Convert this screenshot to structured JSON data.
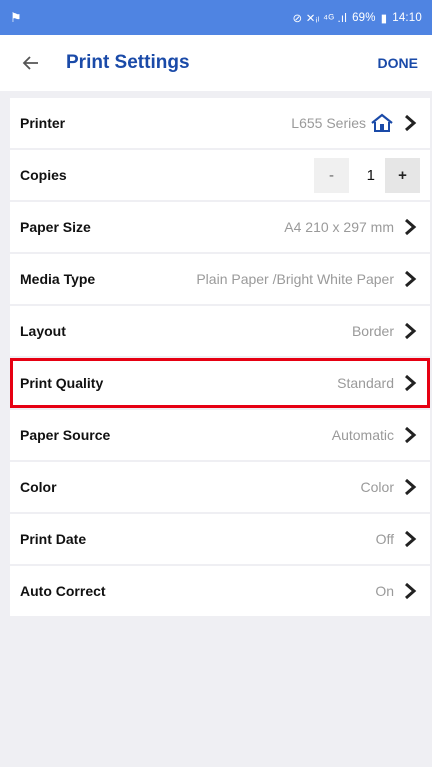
{
  "status_bar": {
    "left_icon": "notification-icon",
    "right_text": "69%",
    "time": "14:10",
    "signal_glyphs": "⊘ ✕ᵢₗ ⁴ᴳ .ıl"
  },
  "header": {
    "back_icon": "arrow-left-icon",
    "title": "Print Settings",
    "done_label": "DONE"
  },
  "settings": {
    "printer": {
      "label": "Printer",
      "value": "L655 Series"
    },
    "copies": {
      "label": "Copies",
      "value": "1",
      "minus": "-",
      "plus": "+"
    },
    "paper_size": {
      "label": "Paper Size",
      "value": "A4 210 x 297 mm"
    },
    "media_type": {
      "label": "Media Type",
      "value": "Plain Paper /Bright White Paper"
    },
    "layout": {
      "label": "Layout",
      "value": "Border"
    },
    "print_quality": {
      "label": "Print Quality",
      "value": "Standard"
    },
    "paper_source": {
      "label": "Paper Source",
      "value": "Automatic"
    },
    "color": {
      "label": "Color",
      "value": "Color"
    },
    "print_date": {
      "label": "Print Date",
      "value": "Off"
    },
    "auto_correct": {
      "label": "Auto Correct",
      "value": "On"
    }
  },
  "colors": {
    "status_bar": "#4f84e2",
    "accent": "#1a4aa8",
    "highlight_border": "#e60012",
    "background": "#efeff3"
  }
}
